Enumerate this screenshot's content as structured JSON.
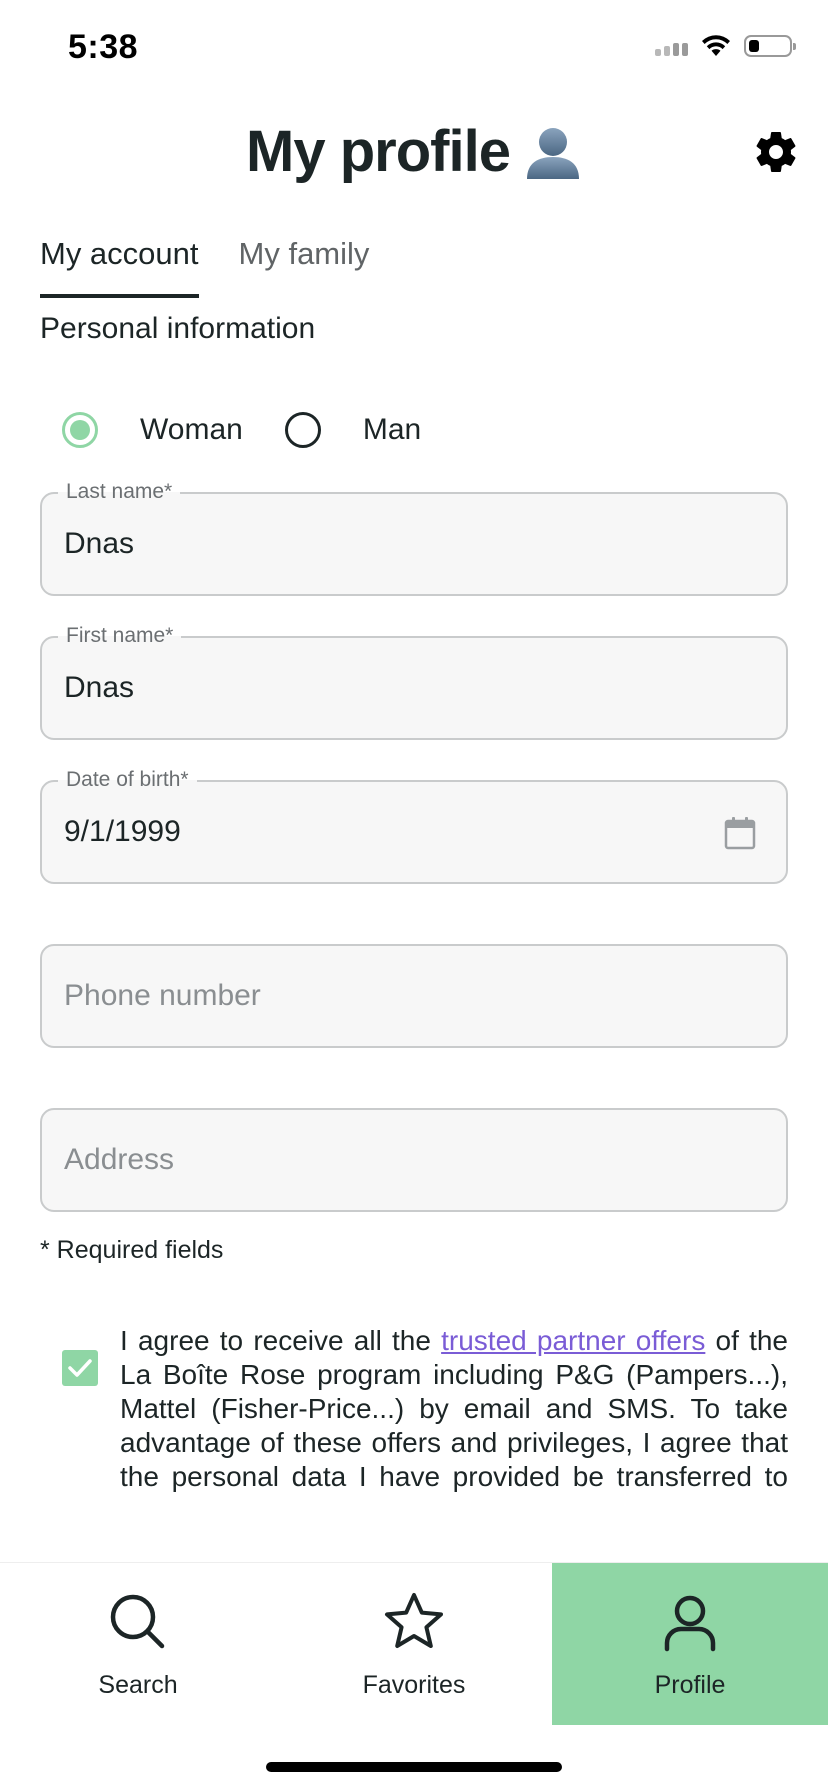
{
  "status_bar": {
    "time": "5:38"
  },
  "header": {
    "title": "My profile",
    "title_emoji": "👤",
    "settings_icon": "gear-icon"
  },
  "tabs": [
    {
      "label": "My account",
      "active": true
    },
    {
      "label": "My family",
      "active": false
    }
  ],
  "section_title": "Personal information",
  "gender": {
    "options": [
      {
        "label": "Woman",
        "selected": true
      },
      {
        "label": "Man",
        "selected": false
      }
    ]
  },
  "form": {
    "last_name": {
      "label": "Last name*",
      "value": "Dnas"
    },
    "first_name": {
      "label": "First name*",
      "value": "Dnas"
    },
    "date_of_birth": {
      "label": "Date of birth*",
      "value": "9/1/1999",
      "icon": "calendar-icon"
    },
    "phone": {
      "placeholder": "Phone number",
      "value": ""
    },
    "address": {
      "placeholder": "Address",
      "value": ""
    },
    "required_note": "* Required fields"
  },
  "consent": {
    "checked": true,
    "text_before": "I agree to receive all the ",
    "link_text": "trusted partner offers",
    "text_after": " of the La Boîte Rose program including P&G (Pampers...), Mattel (Fisher-Price...) by email and SMS. To take advantage of these offers and privileges, I agree that the personal data I have provided be transferred to these partners with the"
  },
  "bottom_nav": [
    {
      "label": "Search",
      "icon": "search-icon",
      "active": false
    },
    {
      "label": "Favorites",
      "icon": "star-icon",
      "active": false
    },
    {
      "label": "Profile",
      "icon": "person-icon",
      "active": true
    }
  ],
  "colors": {
    "accent_green": "#8fd6a5",
    "link_purple": "#7a5cd6",
    "text_dark": "#1c2526"
  }
}
